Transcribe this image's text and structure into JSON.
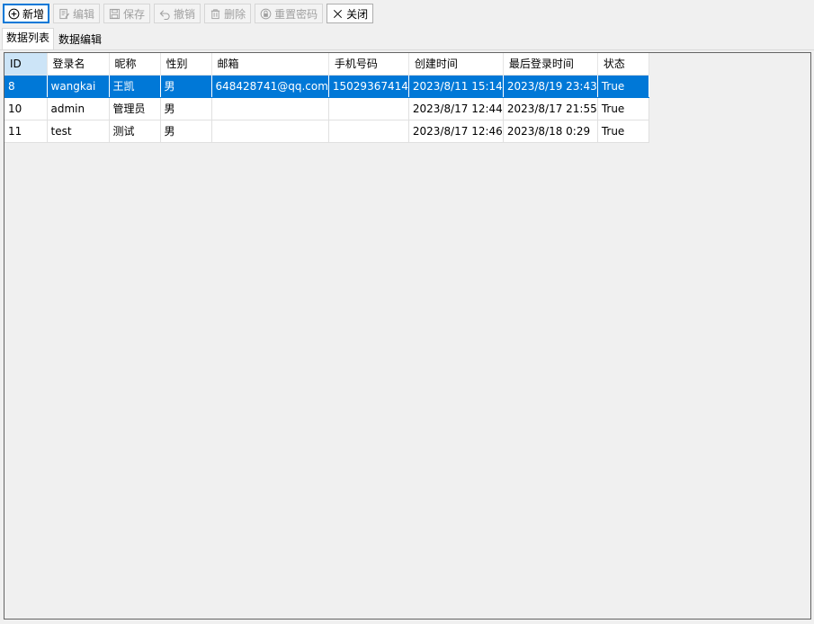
{
  "toolbar": {
    "buttons": [
      {
        "label": "新增",
        "icon": "plus-circle-icon",
        "enabled": true
      },
      {
        "label": "编辑",
        "icon": "edit-icon",
        "enabled": false
      },
      {
        "label": "保存",
        "icon": "save-icon",
        "enabled": false
      },
      {
        "label": "撤销",
        "icon": "undo-icon",
        "enabled": false
      },
      {
        "label": "删除",
        "icon": "trash-icon",
        "enabled": false
      },
      {
        "label": "重置密码",
        "icon": "lock-reset-icon",
        "enabled": false
      },
      {
        "label": "关闭",
        "icon": "close-icon",
        "enabled": true
      }
    ]
  },
  "tabs": {
    "list": "数据列表",
    "edit": "数据编辑"
  },
  "grid": {
    "columns": [
      "ID",
      "登录名",
      "昵称",
      "性别",
      "邮箱",
      "手机号码",
      "创建时间",
      "最后登录时间",
      "状态"
    ],
    "rows": [
      [
        "8",
        "wangkai",
        "王凯",
        "男",
        "648428741@qq.com",
        "15029367414",
        "2023/8/11 15:14",
        "2023/8/19 23:43",
        "True"
      ],
      [
        "10",
        "admin",
        "管理员",
        "男",
        "",
        "",
        "2023/8/17 12:44",
        "2023/8/17 21:55",
        "True"
      ],
      [
        "11",
        "test",
        "测试",
        "男",
        "",
        "",
        "2023/8/17 12:46",
        "2023/8/18 0:29",
        "True"
      ]
    ]
  },
  "colors": {
    "selection": "#0078d7",
    "header_selected": "#cce4f7",
    "focus_border": "#0078d7"
  }
}
